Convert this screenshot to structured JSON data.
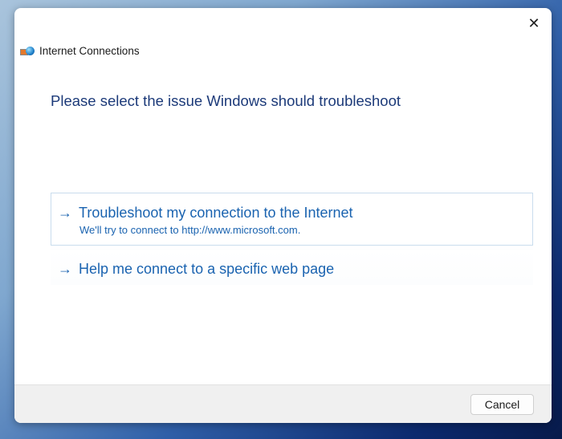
{
  "window": {
    "app_title": "Internet Connections",
    "close_icon": "close-icon"
  },
  "main": {
    "heading": "Please select the issue Windows should troubleshoot",
    "options": [
      {
        "label": "Troubleshoot my connection to the Internet",
        "description": "We'll try to connect to http://www.microsoft.com."
      },
      {
        "label": "Help me connect to a specific web page"
      }
    ],
    "arrow": "→"
  },
  "footer": {
    "cancel_label": "Cancel"
  }
}
